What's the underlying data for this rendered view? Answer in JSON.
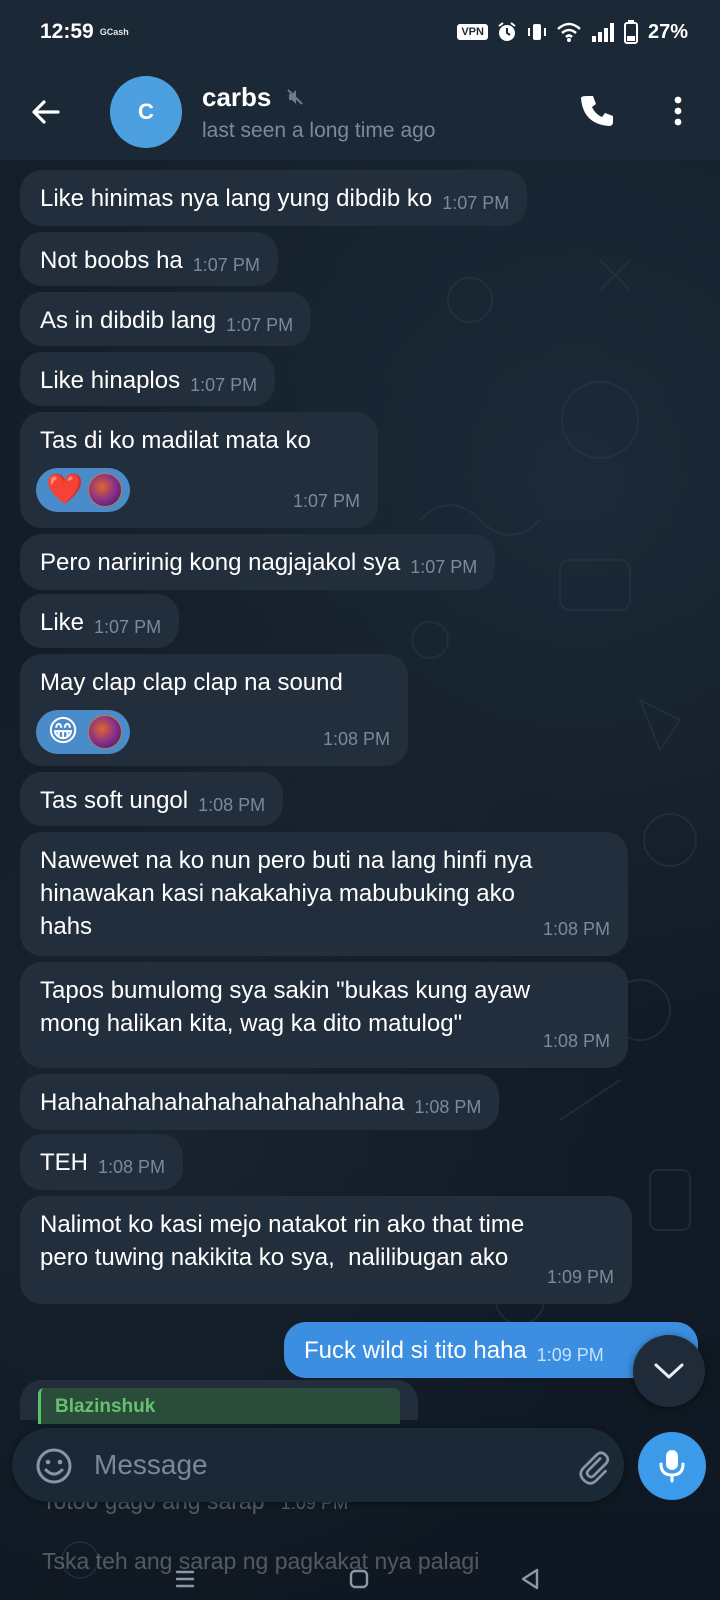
{
  "status_bar": {
    "time": "12:59",
    "notification_app": "GCash",
    "vpn_label": "VPN",
    "battery": "27%",
    "icons": [
      "vpn-icon",
      "alarm-icon",
      "vibrate-icon",
      "wifi-icon",
      "signal-icon",
      "battery-icon"
    ]
  },
  "header": {
    "avatar_letter": "C",
    "avatar_color": "#4da0e0",
    "contact_name": "carbs",
    "contact_status": "last seen a long time ago"
  },
  "messages": [
    {
      "text": "Like hinimas nya lang yung dibdib ko",
      "time": "1:07 PM"
    },
    {
      "text": "Not boobs ha",
      "time": "1:07 PM"
    },
    {
      "text": "As in dibdib lang",
      "time": "1:07 PM"
    },
    {
      "text": "Like hinaplos",
      "time": "1:07 PM"
    },
    {
      "text": "Tas di ko madilat mata ko",
      "time": "1:07 PM",
      "reaction": "❤️"
    },
    {
      "text": "Pero naririnig kong nagjajakol sya",
      "time": "1:07 PM"
    },
    {
      "text": "Like",
      "time": "1:07 PM"
    },
    {
      "text": "May clap clap clap na sound",
      "time": "1:08 PM",
      "reaction": "😁"
    },
    {
      "text": "Tas soft ungol",
      "time": "1:08 PM"
    },
    {
      "text": "Nawewet na ko nun pero buti na lang hinfi nya\nhinawakan kasi nakakahiya mabubuking ako\nhahs",
      "time": "1:08 PM"
    },
    {
      "text": "Tapos bumulomg sya sakin \"bukas kung ayaw\nmong halikan kita, wag ka dito matulog\"",
      "time": "1:08 PM"
    },
    {
      "text": "Hahahahahahahahahahahahhaha",
      "time": "1:08 PM"
    },
    {
      "text": "TEH",
      "time": "1:08 PM"
    },
    {
      "text": "Nalimot ko kasi mejo natakot rin ako that time\npero tuwing nakikita ko sya,  nalilibugan ako",
      "time": "1:09 PM"
    }
  ],
  "outgoing": [
    {
      "text": "Fuck wild si tito haha",
      "time": "1:09 PM"
    }
  ],
  "reply_preview": {
    "sender": "Blazinshuk",
    "sender_color": "#66c26f"
  },
  "faded_messages": [
    {
      "text": "Totoo gago ang sarap",
      "time": "1:09 PM"
    },
    {
      "text": "Tska teh ang sarap ng pagkakat nya palagi"
    }
  ],
  "composer": {
    "placeholder": "Message"
  },
  "colors": {
    "incoming_bubble": "#222e3b",
    "outgoing_bubble": "#3c8ee1",
    "header_bg": "#1b2835",
    "accent": "#3c9ae8"
  }
}
